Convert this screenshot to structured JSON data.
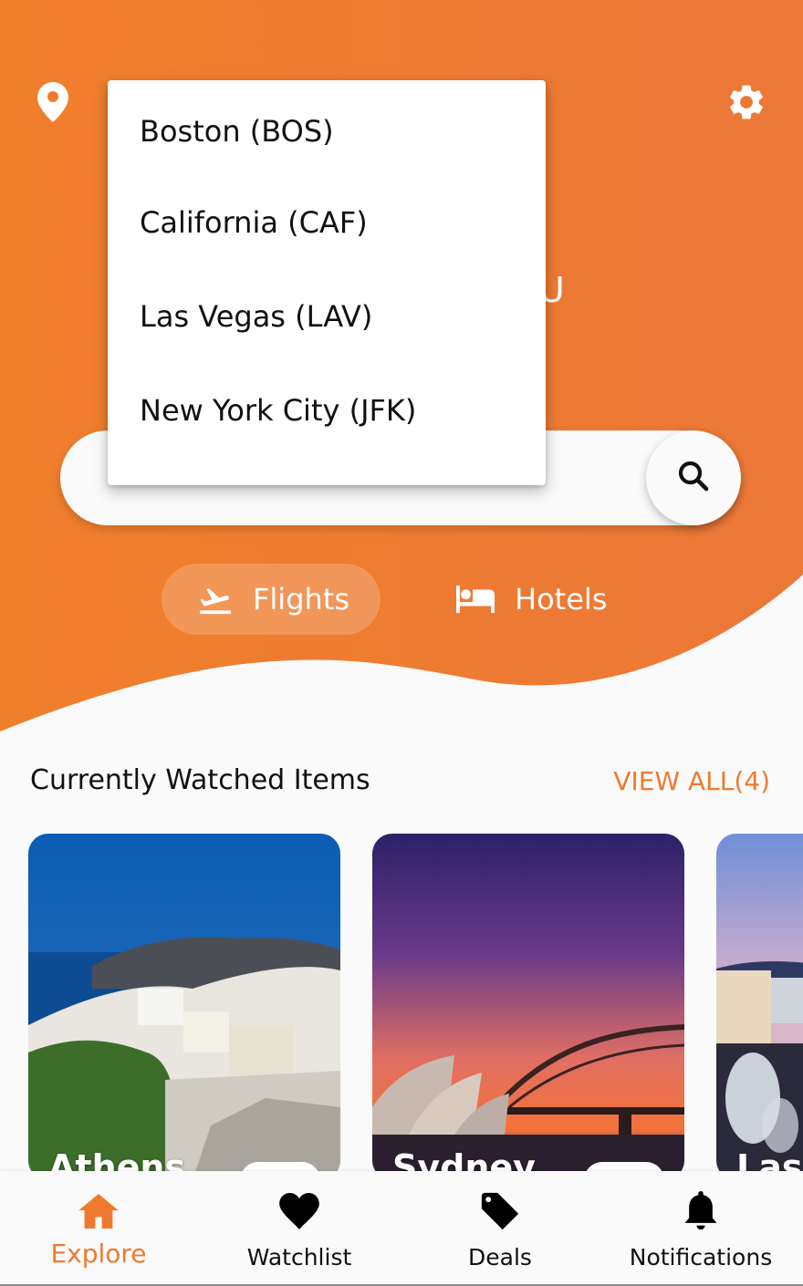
{
  "colors": {
    "brand": "#ef7a2e",
    "brand_light": "#f28a44",
    "background": "#fafafa",
    "text": "#111111",
    "white": "#ffffff"
  },
  "header": {
    "location_icon": "location-pin-icon",
    "settings_icon": "gear-icon",
    "heading_visible_fragment": "OU"
  },
  "location_dropdown": {
    "options": [
      {
        "label": "Boston (BOS)"
      },
      {
        "label": "California (CAF)"
      },
      {
        "label": "Las Vegas (LAV)"
      },
      {
        "label": "New York City (JFK)"
      }
    ]
  },
  "search": {
    "value": "",
    "placeholder": "",
    "button_icon": "search-icon"
  },
  "mode_tabs": [
    {
      "label": "Flights",
      "icon": "flight-takeoff-icon",
      "active": true
    },
    {
      "label": "Hotels",
      "icon": "bed-icon",
      "active": false
    }
  ],
  "watched": {
    "title": "Currently Watched Items",
    "view_all_label": "VIEW ALL(4)",
    "items": [
      {
        "name": "Athens"
      },
      {
        "name": "Sydney"
      },
      {
        "name": "Las V"
      }
    ]
  },
  "bottom_nav": [
    {
      "label": "Explore",
      "icon": "home-icon",
      "active": true
    },
    {
      "label": "Watchlist",
      "icon": "heart-icon",
      "active": false
    },
    {
      "label": "Deals",
      "icon": "tag-icon",
      "active": false
    },
    {
      "label": "Notifications",
      "icon": "bell-icon",
      "active": false
    }
  ]
}
